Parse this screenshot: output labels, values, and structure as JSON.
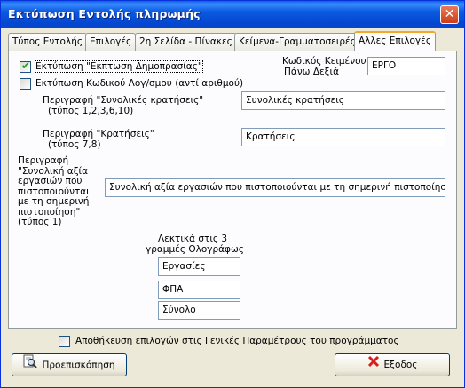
{
  "window": {
    "title": "Εκτύπωση Εντολής πληρωμής",
    "close_symbol": "✕"
  },
  "tabs": [
    {
      "label": "Τύπος Εντολής",
      "active": false
    },
    {
      "label": "Επιλογές",
      "active": false
    },
    {
      "label": "2η Σελίδα - Πίνακες",
      "active": false
    },
    {
      "label": "Κείμενα-Γραμματοσειρές",
      "active": false
    },
    {
      "label": "Αλλες Επιλογές",
      "active": true
    }
  ],
  "options": {
    "print_auction_discount": {
      "label": "Εκτύπωση \"Εκπτωση Δημοπρασίας\"",
      "checked": true
    },
    "print_account_code": {
      "label": "Εκτύπωση Κωδικού Λογ/σμου (αντί αριθμού)",
      "checked": false
    }
  },
  "top_right": {
    "label_line1": "Κωδικός Κειμένου",
    "label_line2": "Πάνω Δεξιά",
    "value": "ΕΡΓΟ"
  },
  "fields": {
    "total_deductions": {
      "label_line1": "Περιγραφή \"Συνολικές κρατήσεις\"",
      "label_line2": "(τύπος 1,2,3,6,10)",
      "value": "Συνολικές κρατήσεις"
    },
    "deductions": {
      "label_line1": "Περιγραφή \"Κρατήσεις\"",
      "label_line2": "(τύπος 7,8)",
      "value": "Κρατήσεις"
    },
    "total_work_value": {
      "label_lines": [
        "Περιγραφή",
        "\"Συνολική αξία",
        "εργασιών που",
        "πιστοποιούνται",
        "με τη σημερινή",
        "πιστοποίηση\"",
        "(τύπος 1)"
      ],
      "value": "Συνολική αξία εργασιών που πιστοποιούνται με τη σημερινή πιστοποίηση"
    }
  },
  "words_section": {
    "label_line1": "Λεκτικά στις  3",
    "label_line2": "γραμμές Ολογράφως",
    "lines": [
      "Εργασίες",
      "ΦΠΑ",
      "Σύνολο"
    ]
  },
  "save_option": {
    "label": "Αποθήκευση επιλογών στις Γενικές Παραμέτρους του προγράμματος",
    "checked": false
  },
  "buttons": {
    "preview": "Προεπισκόπηση",
    "exit": "Εξοδος"
  },
  "colors": {
    "titlebar": "#0a5fe6",
    "dialog_bg": "#ece9d8",
    "active_tab_accent": "#f0a92d",
    "check_mark": "#21a121",
    "exit_icon": "#d42020"
  },
  "icons": {
    "preview": "magnifier-page-icon",
    "exit": "red-x-icon",
    "close": "close-icon"
  }
}
